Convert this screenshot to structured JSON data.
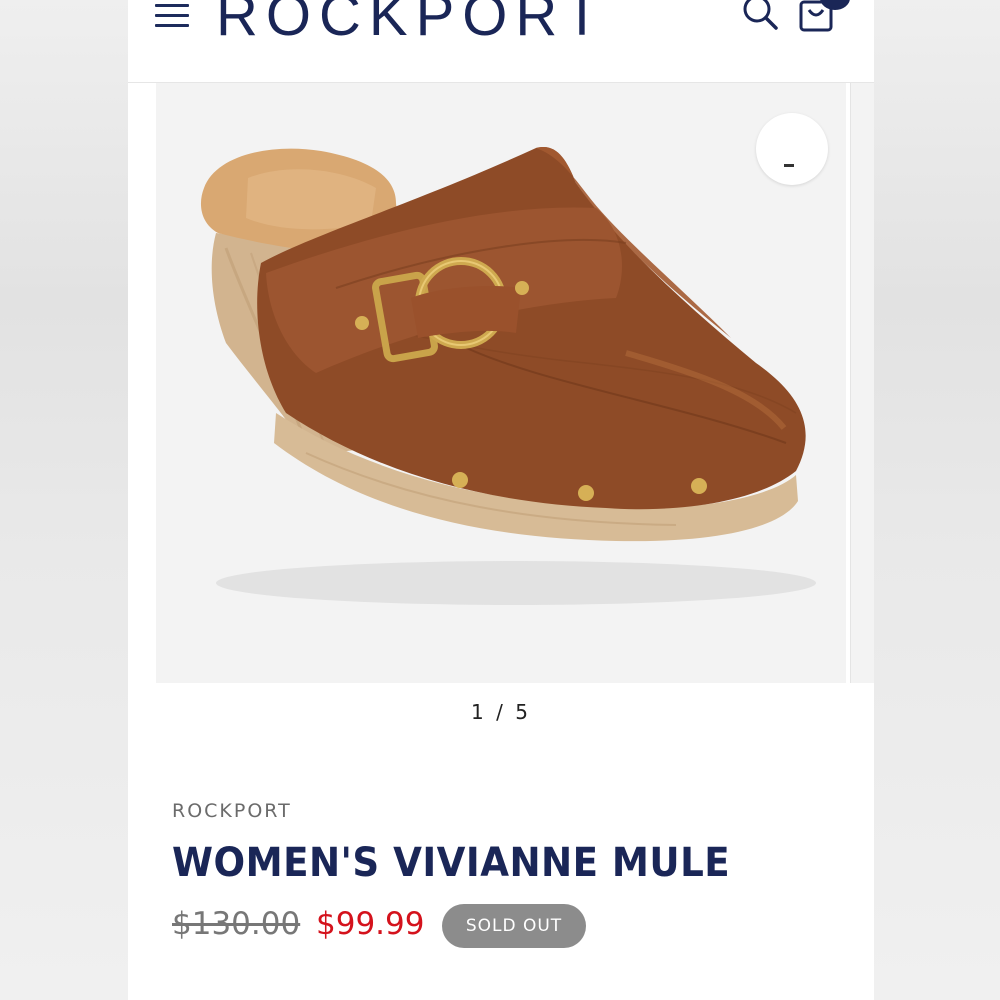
{
  "header": {
    "logo_text": "ROCKPORT",
    "cart_count": ""
  },
  "gallery": {
    "current": "1",
    "separator": "/",
    "total": "5",
    "image_subject": "brown leather clog mule with gold ring buckle and wood heel"
  },
  "product": {
    "brand": "ROCKPORT",
    "title": "WOMEN'S VIVIANNE MULE",
    "original_price": "$130.00",
    "sale_price": "$99.99",
    "status_badge": "SOLD OUT"
  },
  "colors": {
    "brand_navy": "#1a2657",
    "sale_red": "#d4121c",
    "badge_gray": "#8c8c8c"
  },
  "icons": [
    "hamburger-menu-icon",
    "search-icon",
    "shopping-bag-icon",
    "zoom-icon"
  ]
}
